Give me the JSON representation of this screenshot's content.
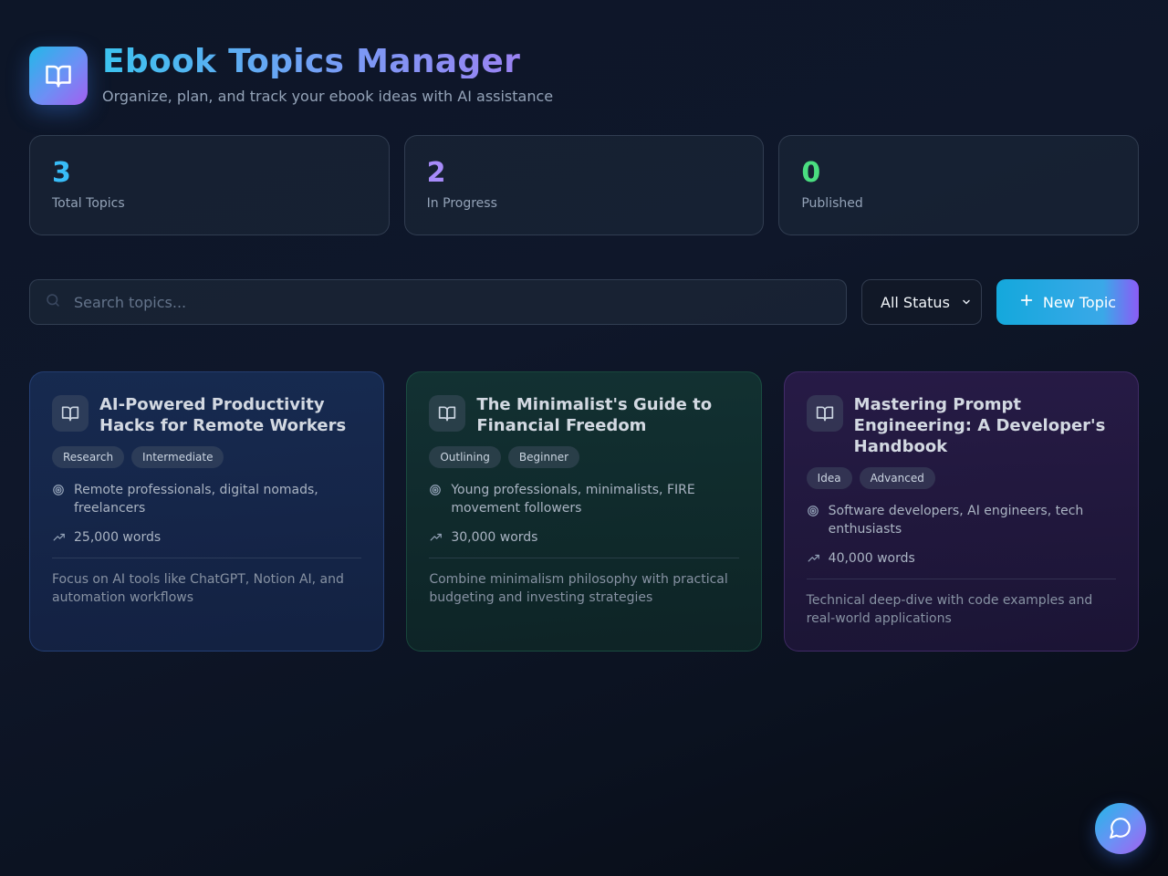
{
  "header": {
    "title": "Ebook Topics Manager",
    "subtitle": "Organize, plan, and track your ebook ideas with AI assistance",
    "logo_icon": "book-open-icon"
  },
  "stats": [
    {
      "value": "3",
      "label": "Total Topics",
      "color": "#38bdf8"
    },
    {
      "value": "2",
      "label": "In Progress",
      "color": "#a78bfa"
    },
    {
      "value": "0",
      "label": "Published",
      "color": "#4ade80"
    }
  ],
  "toolbar": {
    "search_placeholder": "Search topics...",
    "status_filter": {
      "selected": "All Status"
    },
    "new_topic_label": "New Topic"
  },
  "topics": [
    {
      "title": "AI-Powered Productivity Hacks for Remote Workers",
      "status": "Research",
      "level": "Intermediate",
      "audience": "Remote professionals, digital nomads, freelancers",
      "words": "25,000 words",
      "notes": "Focus on AI tools like ChatGPT, Notion AI, and automation workflows",
      "theme": "blue"
    },
    {
      "title": "The Minimalist's Guide to Financial Freedom",
      "status": "Outlining",
      "level": "Beginner",
      "audience": "Young professionals, minimalists, FIRE movement followers",
      "words": "30,000 words",
      "notes": "Combine minimalism philosophy with practical budgeting and investing strategies",
      "theme": "green"
    },
    {
      "title": "Mastering Prompt Engineering: A Developer's Handbook",
      "status": "Idea",
      "level": "Advanced",
      "audience": "Software developers, AI engineers, tech enthusiasts",
      "words": "40,000 words",
      "notes": "Technical deep-dive with code examples and real-world applications",
      "theme": "purple"
    }
  ],
  "chat_button_icon": "chat-bubble-icon"
}
